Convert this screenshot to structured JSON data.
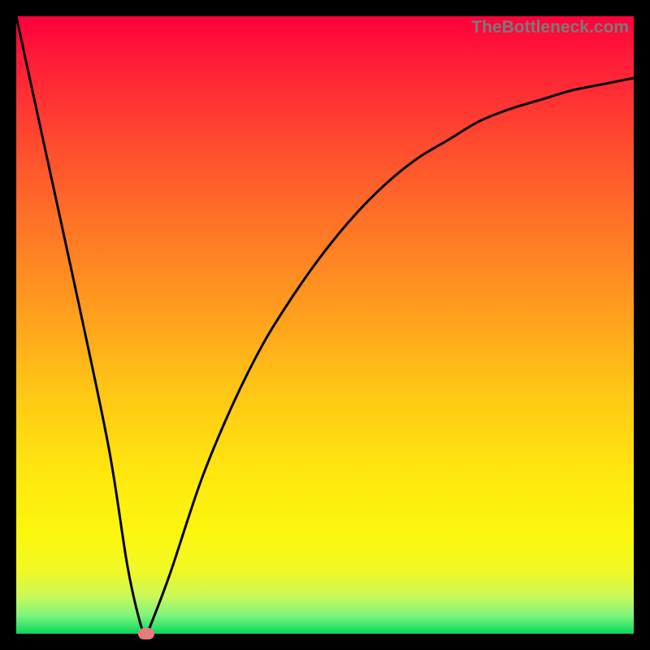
{
  "attribution": "TheBottleneck.com",
  "colors": {
    "page_bg": "#000000",
    "curve": "#000000",
    "marker": "#e97b7b"
  },
  "chart_data": {
    "type": "line",
    "title": "",
    "xlabel": "",
    "ylabel": "",
    "xlim": [
      0,
      100
    ],
    "ylim": [
      0,
      100
    ],
    "y_background_gradient": "red-to-green top-to-bottom (bottleneck severity scale)",
    "series": [
      {
        "name": "bottleneck-curve",
        "x": [
          0,
          5,
          10,
          15,
          18,
          20,
          21,
          22,
          25,
          30,
          35,
          40,
          45,
          50,
          55,
          60,
          65,
          70,
          75,
          80,
          85,
          90,
          95,
          100
        ],
        "y": [
          100,
          77,
          54,
          30,
          11,
          2,
          0,
          2,
          10,
          25,
          37,
          47,
          55,
          62,
          68,
          73,
          77,
          80,
          83,
          85,
          86.5,
          88,
          89,
          90
        ]
      }
    ],
    "marker": {
      "x": 21,
      "y": 0,
      "label": ""
    },
    "grid": false,
    "legend": false
  }
}
